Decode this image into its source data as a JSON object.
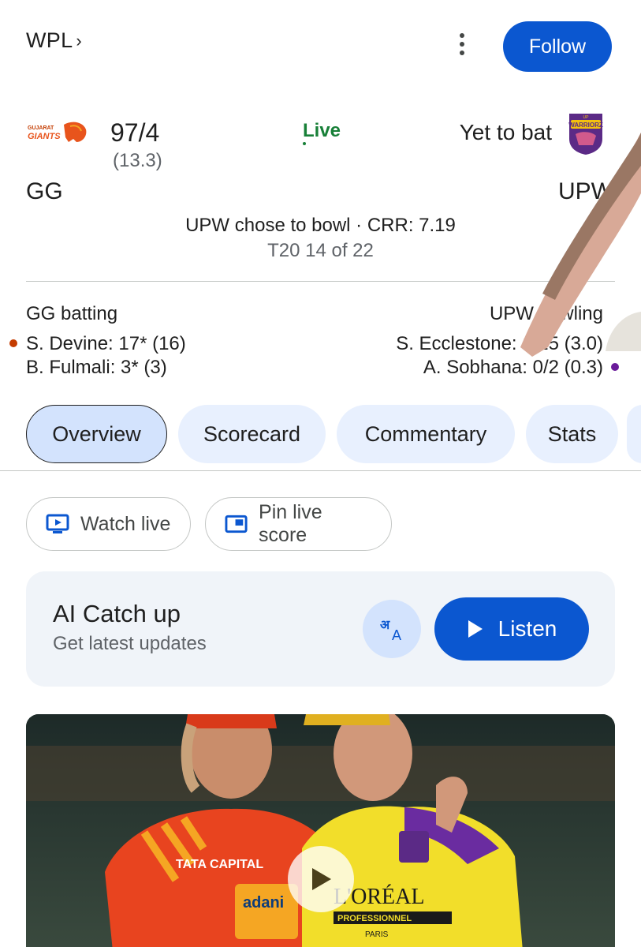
{
  "header": {
    "breadcrumb": "WPL",
    "breadcrumb_chevron": "›",
    "more_icon": "more-vert-icon",
    "follow_label": "Follow"
  },
  "match": {
    "team1": {
      "abbr": "GG",
      "score": "97/4",
      "overs": "(13.3)",
      "logo": "gujarat-giants-logo",
      "logo_text": "GUJARAT GIANTS"
    },
    "team2": {
      "abbr": "UPW",
      "status": "Yet to bat",
      "logo": "up-warriorz-logo",
      "logo_text": "UP WARRIORZ"
    },
    "live_label": "Live",
    "toss_line": "UPW chose to bowl · CRR: 7.19",
    "match_line": "T20 14 of 22",
    "batting_header": "GG batting",
    "bowling_header": "UPW bowling",
    "batters": [
      {
        "text": "S. Devine: 17* (16)"
      },
      {
        "text": "B. Fulmali: 3* (3)"
      }
    ],
    "bowlers": [
      {
        "text": "S. Ecclestone: 1/15 (3.0)"
      },
      {
        "text": "A. Sobhana: 0/2 (0.3)"
      }
    ]
  },
  "tabs": [
    {
      "label": "Overview",
      "active": true
    },
    {
      "label": "Scorecard",
      "active": false
    },
    {
      "label": "Commentary",
      "active": false
    },
    {
      "label": "Stats",
      "active": false
    }
  ],
  "chips": {
    "watch_label": "Watch live",
    "watch_icon": "tv-play-icon",
    "pin_label": "Pin live score",
    "pin_icon": "picture-in-picture-icon"
  },
  "ai_card": {
    "title": "AI Catch up",
    "subtitle": "Get latest updates",
    "lang_icon": "translate-icon",
    "listen_label": "Listen",
    "listen_icon": "play-icon"
  },
  "photo": {
    "description_icon": "video-thumbnail",
    "jersey_text_1": "TATA CAPITAL",
    "jersey_text_2": "adani",
    "jersey_text_3": "L'ORÉAL",
    "jersey_text_4": "PROFESSIONNEL",
    "jersey_text_5": "PARIS",
    "play_icon": "play-circle-icon"
  },
  "colors": {
    "primary": "#0b57d0",
    "live_green": "#188038",
    "tab_bg": "#e8f0fe",
    "tab_active_bg": "#d3e3fd",
    "card_bg": "#f0f4f9",
    "gg_orange": "#e8541c",
    "upw_purple": "#6a1b9a"
  }
}
